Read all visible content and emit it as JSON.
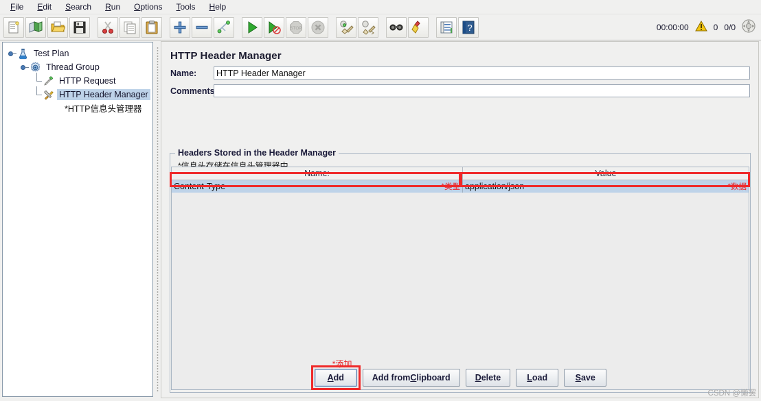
{
  "menubar": {
    "items": [
      {
        "name": "file",
        "pre": "",
        "mn": "F",
        "post": "ile"
      },
      {
        "name": "edit",
        "pre": "",
        "mn": "E",
        "post": "dit"
      },
      {
        "name": "search",
        "pre": "",
        "mn": "S",
        "post": "earch"
      },
      {
        "name": "run",
        "pre": "",
        "mn": "R",
        "post": "un"
      },
      {
        "name": "options",
        "pre": "",
        "mn": "O",
        "post": "ptions"
      },
      {
        "name": "tools",
        "pre": "",
        "mn": "T",
        "post": "ools"
      },
      {
        "name": "help",
        "pre": "",
        "mn": "H",
        "post": "elp"
      }
    ]
  },
  "toolbar": {
    "buttons": [
      {
        "name": "new-icon",
        "title": "New"
      },
      {
        "name": "templates-icon",
        "title": "Templates"
      },
      {
        "name": "open-icon",
        "title": "Open"
      },
      {
        "name": "save-icon",
        "title": "Save"
      },
      {
        "name": "cut-icon",
        "title": "Cut"
      },
      {
        "name": "copy-icon",
        "title": "Copy"
      },
      {
        "name": "paste-icon",
        "title": "Paste"
      },
      {
        "name": "expand-icon",
        "title": "Expand All"
      },
      {
        "name": "collapse-icon",
        "title": "Collapse All"
      },
      {
        "name": "toggle-icon",
        "title": "Toggle"
      },
      {
        "name": "start-icon",
        "title": "Start"
      },
      {
        "name": "start-no-pauses-icon",
        "title": "Start no pauses"
      },
      {
        "name": "stop-icon",
        "title": "Stop"
      },
      {
        "name": "shutdown-icon",
        "title": "Shutdown"
      },
      {
        "name": "clear-icon",
        "title": "Clear"
      },
      {
        "name": "clear-all-icon",
        "title": "Clear All"
      },
      {
        "name": "search-icon",
        "title": "Search"
      },
      {
        "name": "reset-search-icon",
        "title": "Reset Search"
      },
      {
        "name": "function-helper-icon",
        "title": "Function Helper Dialog"
      },
      {
        "name": "help-icon",
        "title": "Help"
      }
    ],
    "status": {
      "timer": "00:00:00",
      "warning_count": "0",
      "threads": "0/0"
    }
  },
  "tree": {
    "nodes": [
      {
        "label": "Test Plan",
        "icon": "test-plan-icon",
        "selected": false
      },
      {
        "label": "Thread Group",
        "icon": "thread-group-icon",
        "selected": false
      },
      {
        "label": "HTTP Request",
        "icon": "http-request-icon",
        "selected": false
      },
      {
        "label": "HTTP Header Manager",
        "icon": "header-manager-icon",
        "selected": true
      }
    ],
    "annotation": "*HTTP信息头管理器"
  },
  "panel": {
    "title": "HTTP Header Manager",
    "name_label": "Name:",
    "name_value": "HTTP Header Manager",
    "comments_label": "Comments:",
    "comments_value": "",
    "group_title": "Headers Stored in the Header Manager",
    "group_note": "*信息头存储在信息头管理器中"
  },
  "table": {
    "columns": [
      "Name:",
      "Value"
    ],
    "rows": [
      {
        "name": "Content-Type",
        "name_note": "*类型",
        "value": "application/json",
        "value_note": "*数据"
      }
    ]
  },
  "buttons": [
    {
      "name": "add-button",
      "pre": "",
      "mn": "A",
      "post": "dd",
      "annotation": "*添加",
      "focused": true,
      "highlighted": true
    },
    {
      "name": "add-from-clipboard-button",
      "pre": "Add from ",
      "mn": "C",
      "post": "lipboard",
      "annotation": "",
      "focused": false,
      "highlighted": false
    },
    {
      "name": "delete-button",
      "pre": "",
      "mn": "D",
      "post": "elete",
      "annotation": "",
      "focused": false,
      "highlighted": false
    },
    {
      "name": "load-button",
      "pre": "",
      "mn": "L",
      "post": "oad",
      "annotation": "",
      "focused": false,
      "highlighted": false
    },
    {
      "name": "save-button",
      "pre": "",
      "mn": "S",
      "post": "ave",
      "annotation": "",
      "focused": false,
      "highlighted": false
    }
  ],
  "watermark": "CSDN @懒罢",
  "colors": {
    "selection": "#bed3e9",
    "annotation": "#e8262b",
    "redbox": "#ef2a2a"
  }
}
